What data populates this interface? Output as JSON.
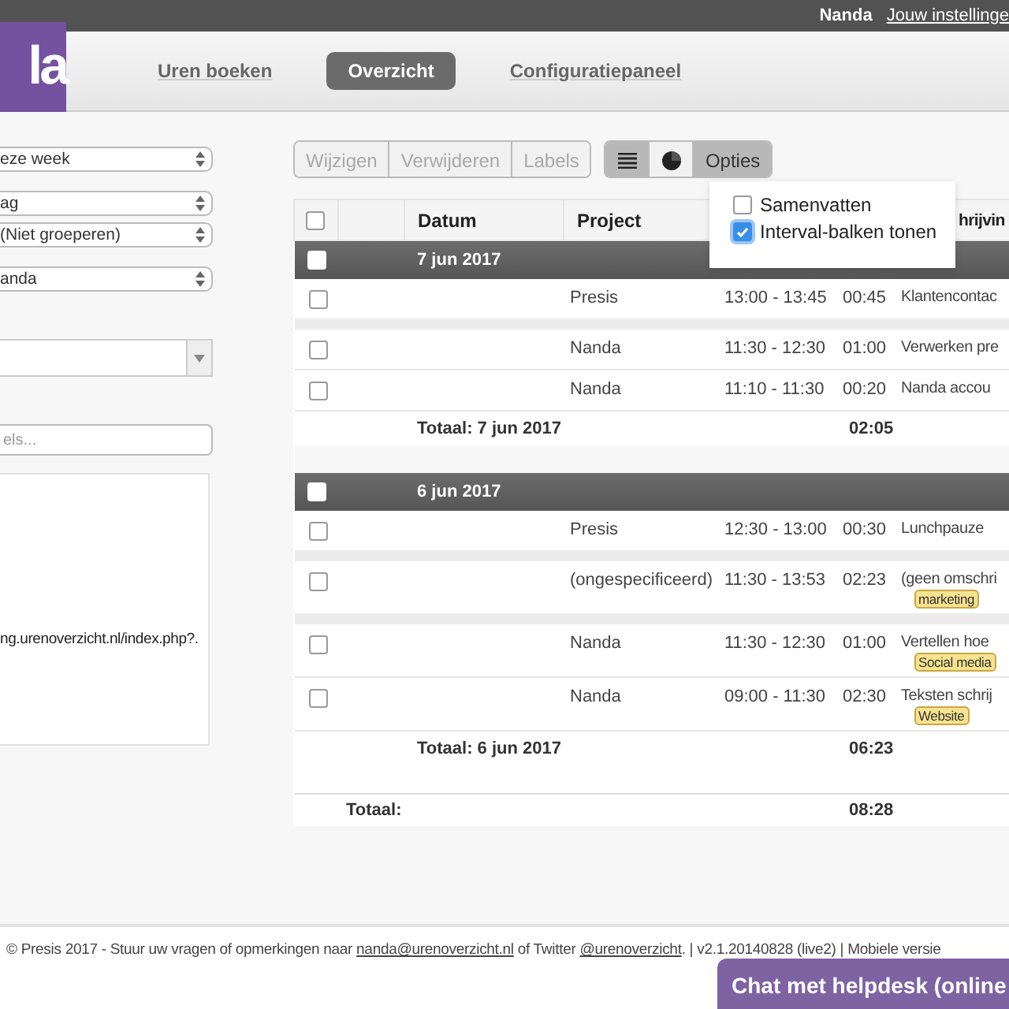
{
  "top_bar": {
    "user": "Nanda",
    "settings_link": "Jouw instellinge"
  },
  "logo": "la",
  "nav": [
    {
      "label": "Uren boeken",
      "selected": false
    },
    {
      "label": "Overzicht",
      "selected": true
    },
    {
      "label": "Configuratiepaneel",
      "selected": false
    }
  ],
  "filters": {
    "selects": [
      "eze week",
      "ag",
      "(Niet groeperen)",
      "anda"
    ],
    "search": {
      "placeholder": "els..."
    },
    "url_text": "ng.urenoverzicht.nl/index.php?."
  },
  "toolbar": {
    "actions": [
      {
        "label": "Wijzigen",
        "disabled": true
      },
      {
        "label": "Verwijderen",
        "disabled": true
      },
      {
        "label": "Labels",
        "disabled": true
      }
    ],
    "views": [
      {
        "kind": "list",
        "selected": true
      },
      {
        "kind": "pie",
        "selected": false
      },
      {
        "kind": "text",
        "label": "Opties",
        "selected": true
      }
    ]
  },
  "options_menu": [
    {
      "label": "Samenvatten",
      "checked": false
    },
    {
      "label": "Interval-balken tonen",
      "checked": true
    }
  ],
  "table": {
    "checked": false,
    "columns": [
      {
        "label": "Datum"
      },
      {
        "label": "Project"
      },
      {
        "label": "hrijvin"
      }
    ],
    "groups": [
      {
        "date": "7 jun 2017",
        "checked": false,
        "total_label": "Totaal: 7 jun 2017",
        "total": "02:05",
        "entries": [
          {
            "project": "Presis",
            "time": "13:00 - 13:45",
            "duration": "00:45",
            "description": "Klantencontac",
            "checked": false,
            "separated": true
          },
          {
            "project": "Nanda",
            "time": "11:30 - 12:30",
            "duration": "01:00",
            "description": "Verwerken pre",
            "checked": false,
            "separated": false
          },
          {
            "project": "Nanda",
            "time": "11:10 - 11:30",
            "duration": "00:20",
            "description": "Nanda accou",
            "checked": false,
            "separated": false
          }
        ]
      },
      {
        "date": "6 jun 2017",
        "checked": false,
        "total_label": "Totaal: 6 jun 2017",
        "total": "06:23",
        "entries": [
          {
            "project": "Presis",
            "time": "12:30 - 13:00",
            "duration": "00:30",
            "description": "Lunchpauze",
            "checked": false,
            "separated": true
          },
          {
            "project": "(ongespecificeerd)",
            "time": "11:30 - 13:53",
            "duration": "02:23",
            "description": "(geen omschri",
            "tag": "marketing",
            "checked": false,
            "separated": true
          },
          {
            "project": "Nanda",
            "time": "11:30 - 12:30",
            "duration": "01:00",
            "description": "Vertellen hoe",
            "tag": "Social media",
            "checked": false,
            "separated": false
          },
          {
            "project": "Nanda",
            "time": "09:00 - 11:30",
            "duration": "02:30",
            "description": "Teksten schrij",
            "tag": "Website",
            "checked": false,
            "separated": false
          }
        ]
      }
    ],
    "grand_total": {
      "label": "Totaal:",
      "value": "08:28"
    }
  },
  "footer": {
    "text": "© Presis 2017 - Stuur uw vragen of opmerkingen naar",
    "email": "nanda@urenoverzicht.nl",
    "mid": "of Twitter",
    "twitter": "@urenoverzicht",
    "version": ". | v2.1.20140828 (live2) | Mobiele versie"
  },
  "chat_button": "Chat met helpdesk (online"
}
